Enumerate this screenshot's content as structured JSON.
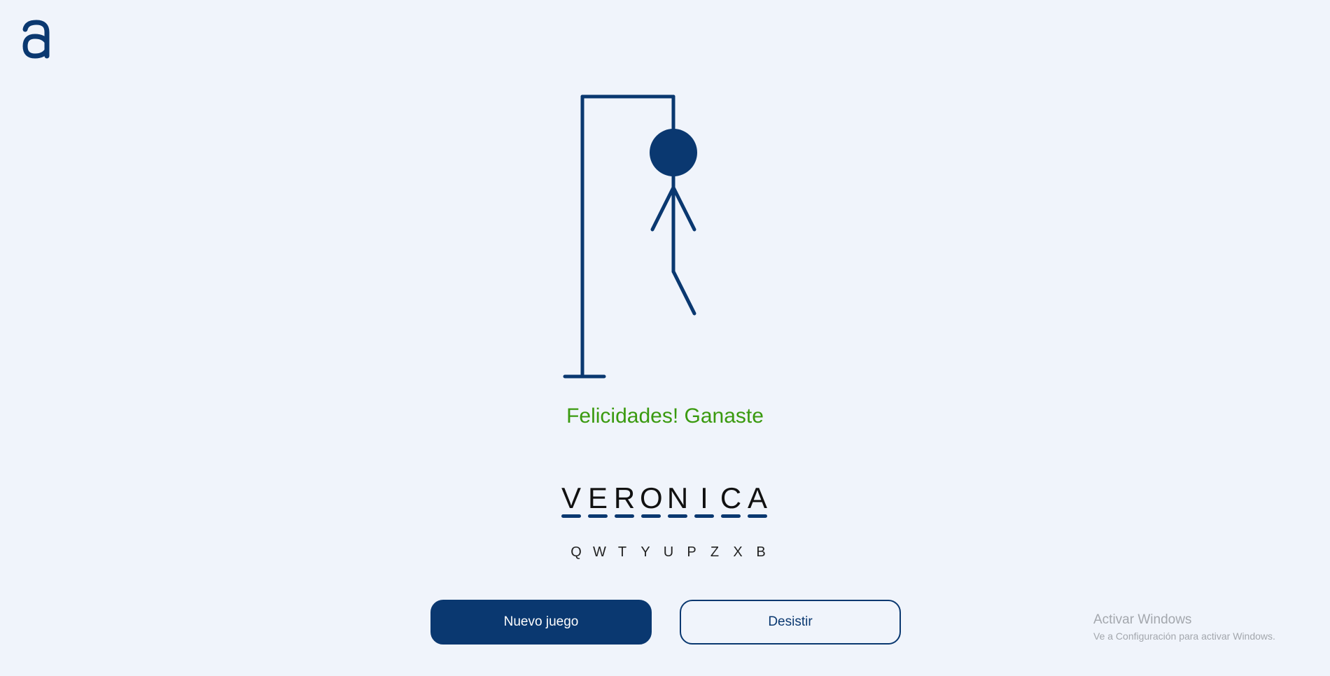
{
  "app": {
    "logo_icon": "letter-a-logo-icon"
  },
  "game": {
    "status_message": "Felicidades! Ganaste",
    "status_color": "#3a9a0f",
    "word_letters": [
      "V",
      "E",
      "R",
      "O",
      "N",
      "I",
      "C",
      "A"
    ],
    "wrong_letters": [
      "Q",
      "W",
      "T",
      "Y",
      "U",
      "P",
      "Z",
      "X",
      "B"
    ]
  },
  "buttons": {
    "new_game_label": "Nuevo juego",
    "give_up_label": "Desistir"
  },
  "watermark": {
    "title": "Activar Windows",
    "subtitle": "Ve a Configuración para activar Windows."
  },
  "colors": {
    "accent": "#0a3870",
    "background": "#f0f4fb"
  }
}
